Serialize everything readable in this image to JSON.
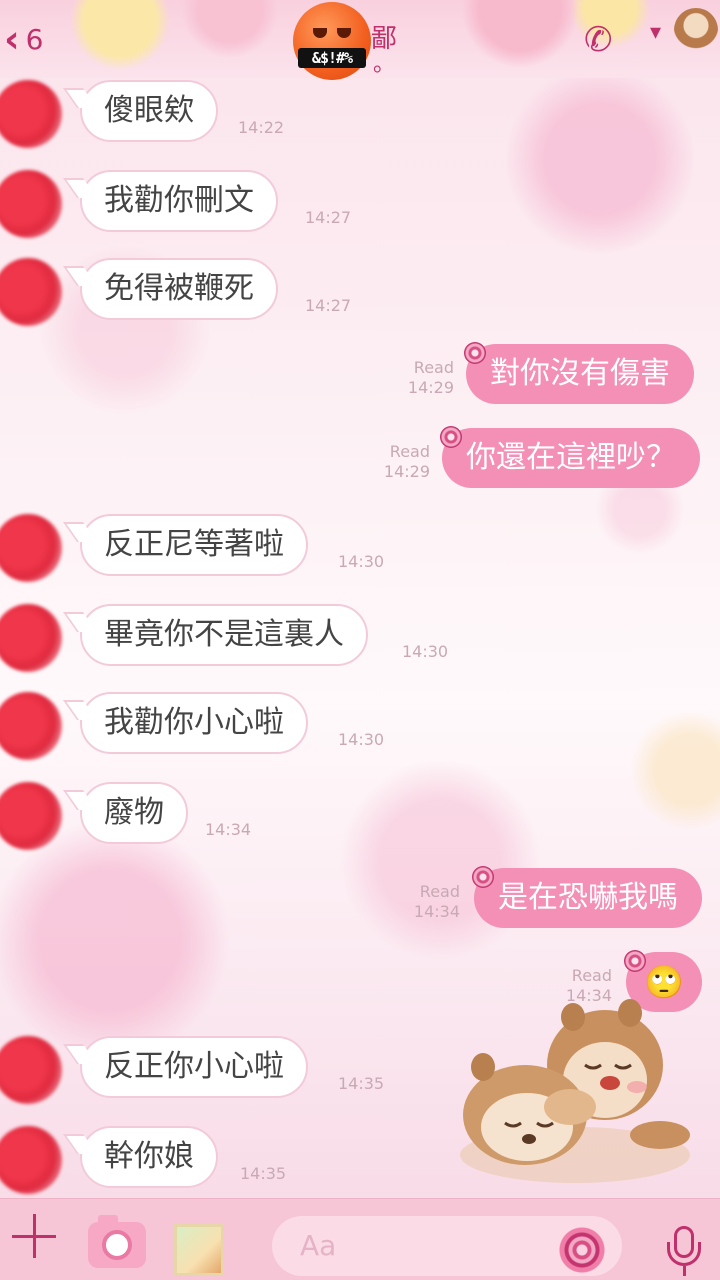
{
  "header": {
    "back_count": "6",
    "title_partial": "鄙",
    "title_dot": "。",
    "emoji_text": "&$!#%"
  },
  "messages": [
    {
      "side": "in",
      "text": "傻眼欸",
      "time": "14:22"
    },
    {
      "side": "in",
      "text": "我勸你刪文",
      "time": "14:27"
    },
    {
      "side": "in",
      "text": "免得被鞭死",
      "time": "14:27"
    },
    {
      "side": "out",
      "text": "對你沒有傷害",
      "read": "Read",
      "time": "14:29"
    },
    {
      "side": "out",
      "text": "你還在這裡吵？",
      "read": "Read",
      "time": "14:29"
    },
    {
      "side": "in",
      "text": "反正尼等著啦",
      "time": "14:30"
    },
    {
      "side": "in",
      "text": "畢竟你不是這裏人",
      "time": "14:30"
    },
    {
      "side": "in",
      "text": "我勸你小心啦",
      "time": "14:30"
    },
    {
      "side": "in",
      "text": "廢物",
      "time": "14:34"
    },
    {
      "side": "out",
      "text": "是在恐嚇我嗎",
      "read": "Read",
      "time": "14:34"
    },
    {
      "side": "out",
      "text": "🙄",
      "read": "Read",
      "time": "14:34"
    },
    {
      "side": "in",
      "text": "反正你小心啦",
      "time": "14:35"
    },
    {
      "side": "in",
      "text": "幹你娘",
      "time": "14:35"
    }
  ],
  "input": {
    "placeholder": "Aa"
  },
  "icons": [
    "back-chevron-icon",
    "phone-icon",
    "dropdown-icon",
    "plus-icon",
    "camera-icon",
    "gallery-icon",
    "sticker-icon",
    "mic-icon"
  ],
  "colors": {
    "accent": "#c0306b",
    "outgoing_bubble": "#f48fb6",
    "incoming_border": "#f3cada"
  }
}
